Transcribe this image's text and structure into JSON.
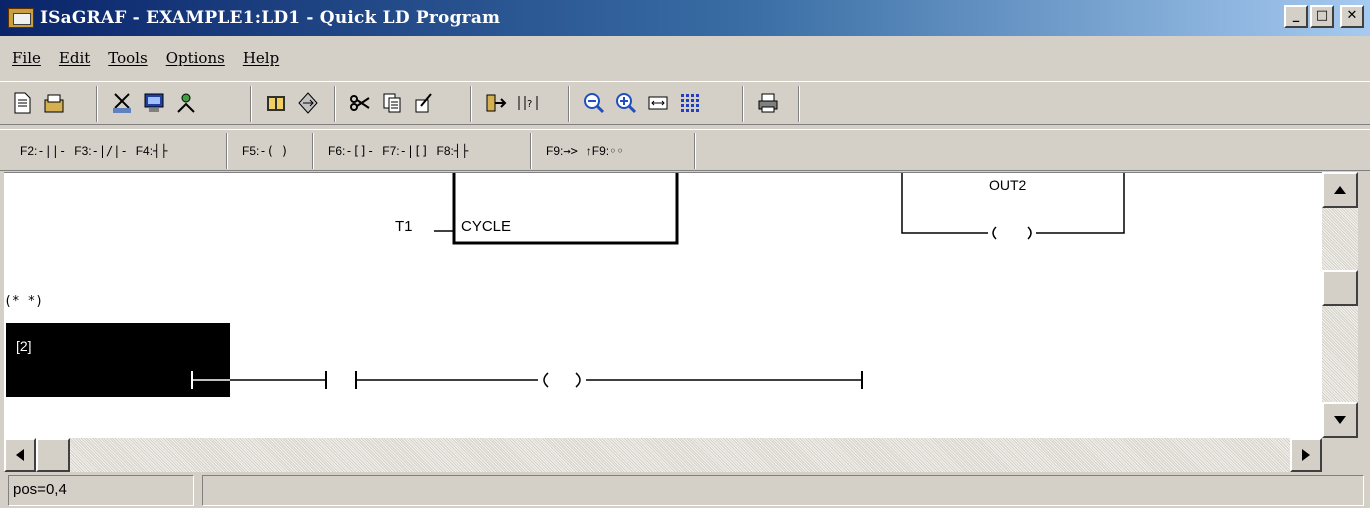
{
  "window": {
    "title": "ISaGRAF - EXAMPLE1:LD1 - Quick LD Program"
  },
  "window_controls": {
    "minimize": "_",
    "maximize": "□",
    "close": "✕"
  },
  "menu": [
    "File",
    "Edit",
    "Tools",
    "Options",
    "Help"
  ],
  "toolbar_icons": [
    "new-document-icon",
    "open-document-icon",
    "cut-dictionary-icon",
    "monitor-icon",
    "network-icon",
    "book-icon",
    "switch-icon",
    "scissors-icon",
    "copy-icon",
    "paste-icon",
    "insert-icon",
    "jump-icon",
    "zoom-out-icon",
    "zoom-in-icon",
    "fit-width-icon",
    "grid-icon",
    "print-icon"
  ],
  "function_keys": [
    {
      "key": "F2:",
      "symbol": "-||-"
    },
    {
      "key": "F3:",
      "symbol": "-|/|-"
    },
    {
      "key": "F4:",
      "symbol": "┤├"
    },
    {
      "key": "F5:",
      "symbol": "-( )"
    },
    {
      "key": "F6:",
      "symbol": "-[]-"
    },
    {
      "key": "F7:",
      "symbol": "-|[]"
    },
    {
      "key": "F8:",
      "symbol": "┤├"
    },
    {
      "key": "F9:",
      "symbol": "→>"
    },
    {
      "key": "↑F9:",
      "symbol": "◦◦"
    }
  ],
  "diagram": {
    "t1_label": "T1",
    "block_input": "CYCLE",
    "out2_label": "OUT2",
    "comment": "(* *)",
    "rung_number": "[2]"
  },
  "status": {
    "position": "pos=0,4"
  },
  "colors": {
    "title_start": "#0a246a",
    "title_end": "#a6caf0",
    "face": "#d4d0c8",
    "rung_highlight": "#000000"
  }
}
